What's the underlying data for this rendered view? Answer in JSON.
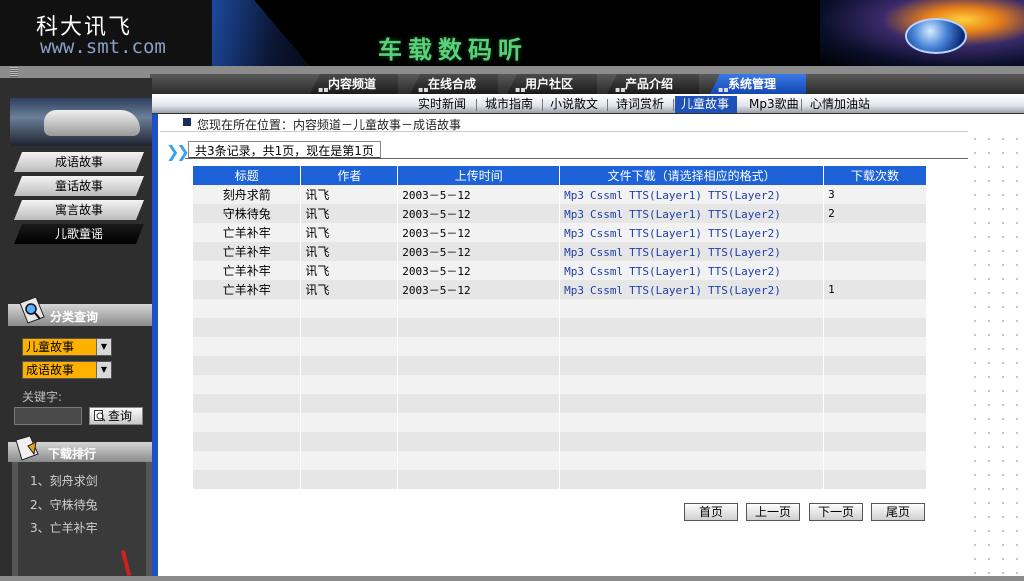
{
  "header": {
    "logo_title": "科大讯飞",
    "logo_url": "www.smt.com",
    "slogan": "车载数码听"
  },
  "nav": {
    "tabs": [
      {
        "label": "内容频道"
      },
      {
        "label": "在线合成"
      },
      {
        "label": "用户社区"
      },
      {
        "label": "产品介绍"
      },
      {
        "label": "系统管理",
        "active": true
      }
    ],
    "subtabs": [
      {
        "label": "实时新闻"
      },
      {
        "label": "城市指南"
      },
      {
        "label": "小说散文"
      },
      {
        "label": "诗词赏析"
      },
      {
        "label": "儿童故事",
        "active": true
      },
      {
        "label": "Mp3歌曲"
      },
      {
        "label": "心情加油站"
      }
    ]
  },
  "sidebar": {
    "categories": [
      {
        "label": "成语故事"
      },
      {
        "label": "童话故事"
      },
      {
        "label": "寓言故事"
      },
      {
        "label": "儿歌童谣",
        "active": true
      }
    ],
    "search": {
      "heading": "分类查询",
      "select1": "儿童故事",
      "select2": "成语故事",
      "keyword_label": "关键字:",
      "keyword_value": "",
      "query_button": "查询"
    },
    "ranking": {
      "heading": "下载排行",
      "items": [
        "1、刻舟求剑",
        "2、守株待兔",
        "3、亡羊补牢"
      ]
    }
  },
  "breadcrumb": "您现在所在位置：内容频道－儿童故事－成语故事",
  "summary": "共3条记录，共1页，现在是第1页",
  "table": {
    "headers": [
      "标题",
      "作者",
      "上传时间",
      "文件下载（请选择相应的格式）",
      "下载次数"
    ],
    "link_labels": [
      "Mp3",
      "Cssml",
      "TTS(Layer1)",
      "TTS(Layer2)"
    ],
    "rows": [
      {
        "title": "刻舟求箭",
        "author": "讯飞",
        "date": "2003－5－12",
        "count": "3"
      },
      {
        "title": "守株待兔",
        "author": "讯飞",
        "date": "2003－5－12",
        "count": "2"
      },
      {
        "title": "亡羊补牢",
        "author": "讯飞",
        "date": "2003－5－12",
        "count": ""
      },
      {
        "title": "亡羊补牢",
        "author": "讯飞",
        "date": "2003－5－12",
        "count": ""
      },
      {
        "title": "亡羊补牢",
        "author": "讯飞",
        "date": "2003－5－12",
        "count": ""
      },
      {
        "title": "亡羊补牢",
        "author": "讯飞",
        "date": "2003－5－12",
        "count": "1"
      }
    ],
    "empty_rows": 10
  },
  "pager": {
    "first": "首页",
    "prev": "上一页",
    "next": "下一页",
    "last": "尾页"
  },
  "colors": {
    "accent_blue": "#1d62d8",
    "nav_active": "#1f52b8",
    "select_orange": "#ffb100",
    "link_blue": "#1d3fa8"
  }
}
